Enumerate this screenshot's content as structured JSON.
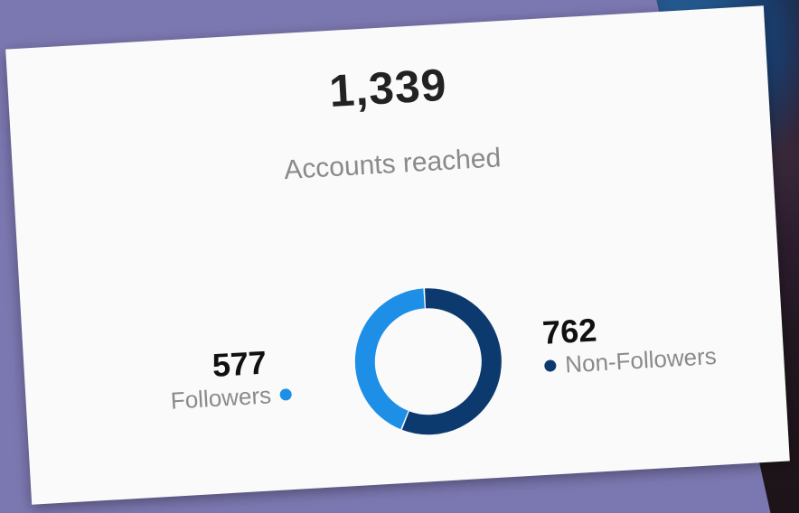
{
  "reach": {
    "total": "1,339",
    "label": "Accounts reached"
  },
  "segments": [
    {
      "label": "Followers",
      "value": "577",
      "count": 577,
      "color": "#1e8fe6"
    },
    {
      "label": "Non-Followers",
      "value": "762",
      "count": 762,
      "color": "#0d3a6e"
    }
  ]
}
